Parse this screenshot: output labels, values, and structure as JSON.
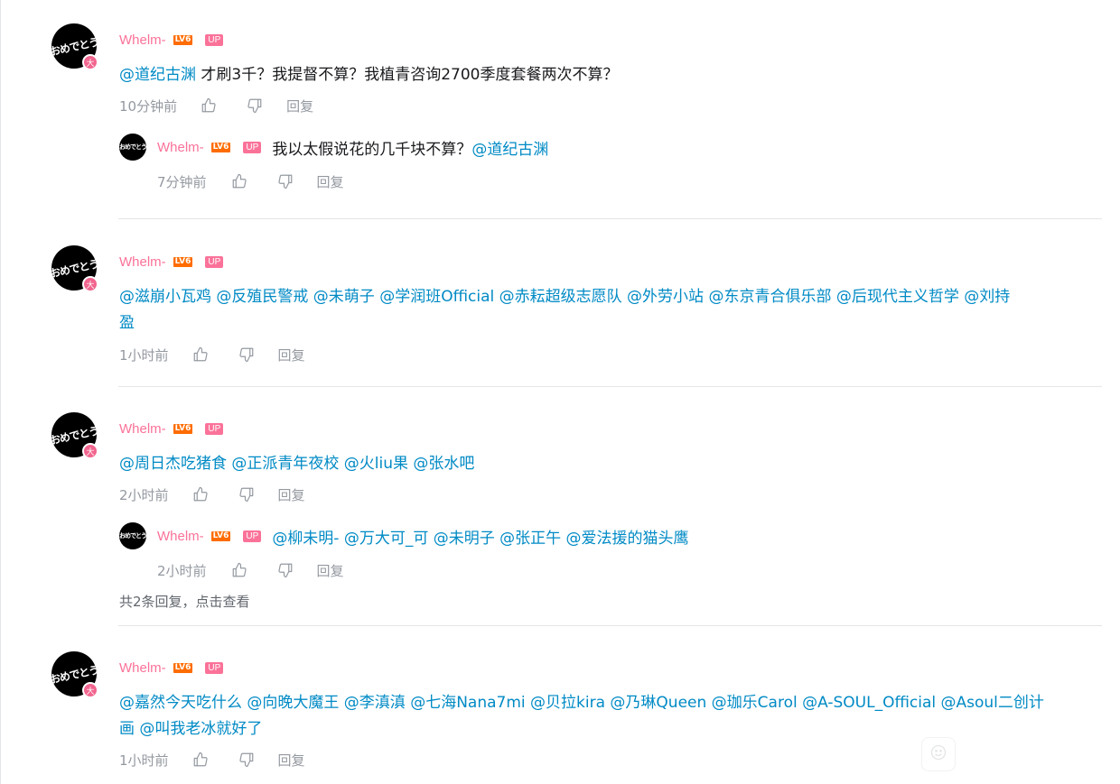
{
  "icons": {
    "like": "thumbs-up-icon",
    "dislike": "thumbs-down-icon"
  },
  "colors": {
    "username": "#fb7299",
    "mention": "#008ac5",
    "level_badge": "#ff6c00",
    "meta": "#9499a0"
  },
  "reply_label": "回复",
  "comments": [
    {
      "user": "Whelm-",
      "level": "LV6",
      "up_tag": "UP",
      "avatar_text": "おめでとう",
      "avatar_badge": "大",
      "content_pre": "@道纪古渊",
      "content_text": " 才刷3千？我提督不算？我植青咨询2700季度套餐两次不算？",
      "time": "10分钟前",
      "replies": [
        {
          "user": "Whelm-",
          "level": "LV6",
          "up_tag": "UP",
          "avatar_text": "おめでとう",
          "text": "我以太假说花的几千块不算？",
          "mention": "@道纪古渊",
          "time": "7分钟前"
        }
      ]
    },
    {
      "user": "Whelm-",
      "level": "LV6",
      "up_tag": "UP",
      "avatar_text": "おめでとう",
      "avatar_badge": "大",
      "content_line1": "@滋崩小瓦鸡 @反殖民警戒 @未萌子 @学润班Official @赤耘超级志愿队 @外劳小站 @东京青合俱乐部 @后现代主义哲学 @刘持",
      "content_line2": "盈",
      "time": "1小时前"
    },
    {
      "user": "Whelm-",
      "level": "LV6",
      "up_tag": "UP",
      "avatar_text": "おめでとう",
      "avatar_badge": "大",
      "content_line1": "@周日杰吃猪食 @正派青年夜校 @火liu果 @张水吧",
      "time": "2小时前",
      "replies": [
        {
          "user": "Whelm-",
          "level": "LV6",
          "up_tag": "UP",
          "avatar_text": "おめでとう",
          "mention": "@柳未明- @万大可_可 @未明子 @张正午 @爱法援的猫头鹰",
          "time": "2小时前"
        }
      ],
      "view_more": "共2条回复，点击查看"
    },
    {
      "user": "Whelm-",
      "level": "LV6",
      "up_tag": "UP",
      "avatar_text": "おめでとう",
      "avatar_badge": "大",
      "content_line1": "@嘉然今天吃什么 @向晚大魔王 @李滇滇 @七海Nana7mi @贝拉kira @乃琳Queen @珈乐Carol @A-SOUL_Official @Asoul二创计",
      "content_line2": "画 @叫我老冰就好了",
      "time": "1小时前"
    }
  ]
}
